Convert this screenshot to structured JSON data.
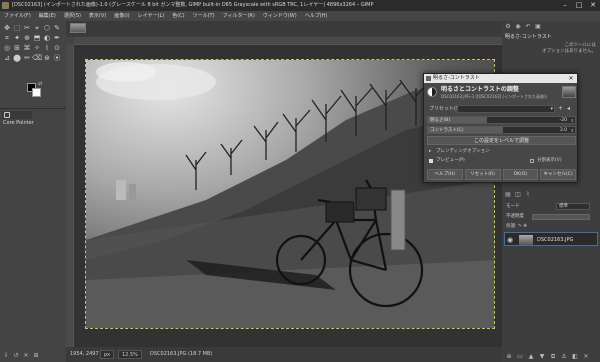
{
  "window": {
    "title": "[DSC02163] (インポートされた画像)-1.0 (グレースケール 8 bit ガンマ整数, GIMP built-in D65 Grayscale with sRGB TRC, 1レイヤー) 4896x3264 – GIMP"
  },
  "menubar": [
    "ファイル(F)",
    "編集(E)",
    "選択(S)",
    "表示(V)",
    "画像(I)",
    "レイヤー(L)",
    "色(C)",
    "ツール(T)",
    "フィルター(R)",
    "ウィンドウ(W)",
    "ヘルプ(H)"
  ],
  "toolbox": {
    "tools": [
      "✥",
      "⬚",
      "✂",
      "⌖",
      "⬡",
      "✎",
      "⌗",
      "✦",
      "⊕",
      "⬒",
      "◐",
      "✒",
      "◎",
      "⊞",
      "⌘",
      "✧",
      "⌇",
      "⊙",
      "⊿",
      "⬤",
      "✏",
      "⌫",
      "⊛",
      "⦿"
    ],
    "options_title": "Core Pointer",
    "bottom_icons": [
      "⇩",
      "↺",
      "✕",
      "⊞"
    ]
  },
  "statusbar": {
    "coords": "1954, 2497",
    "unit": "px",
    "zoom": "12.5%",
    "info": "DSC02163.JPG (18.7 MB)"
  },
  "dock": {
    "title": "明るさ-コントラスト",
    "message": "このツールには\nオプションはありません。",
    "mode_label": "モード",
    "mode_value": "標準",
    "opacity_label": "不透明度",
    "lock_label": "保護:",
    "layer_name": "DSC02163.JPG"
  },
  "dialog": {
    "window_title": "明るさ-コントラスト",
    "heading": "明るさとコントラストの調整",
    "subheading": "DSC02163.JPG-3 ([DSC02163] (インポートされた画像))",
    "preset_label": "プリセット(S):",
    "brightness_label": "明るさ(B)",
    "brightness_value": "-20",
    "brightness_pct": 0.4,
    "contrast_label": "コントラスト(C)",
    "contrast_value": "3.0",
    "contrast_pct": 0.51,
    "edit_levels": "この設定をレベルで調整",
    "blending_label": "ブレンディングオプション",
    "preview_label": "プレビュー(P)",
    "split_label": "分割表示(V)",
    "buttons": [
      "ヘルプ(H)",
      "リセット(R)",
      "OK(O)",
      "キャンセル(C)"
    ]
  }
}
